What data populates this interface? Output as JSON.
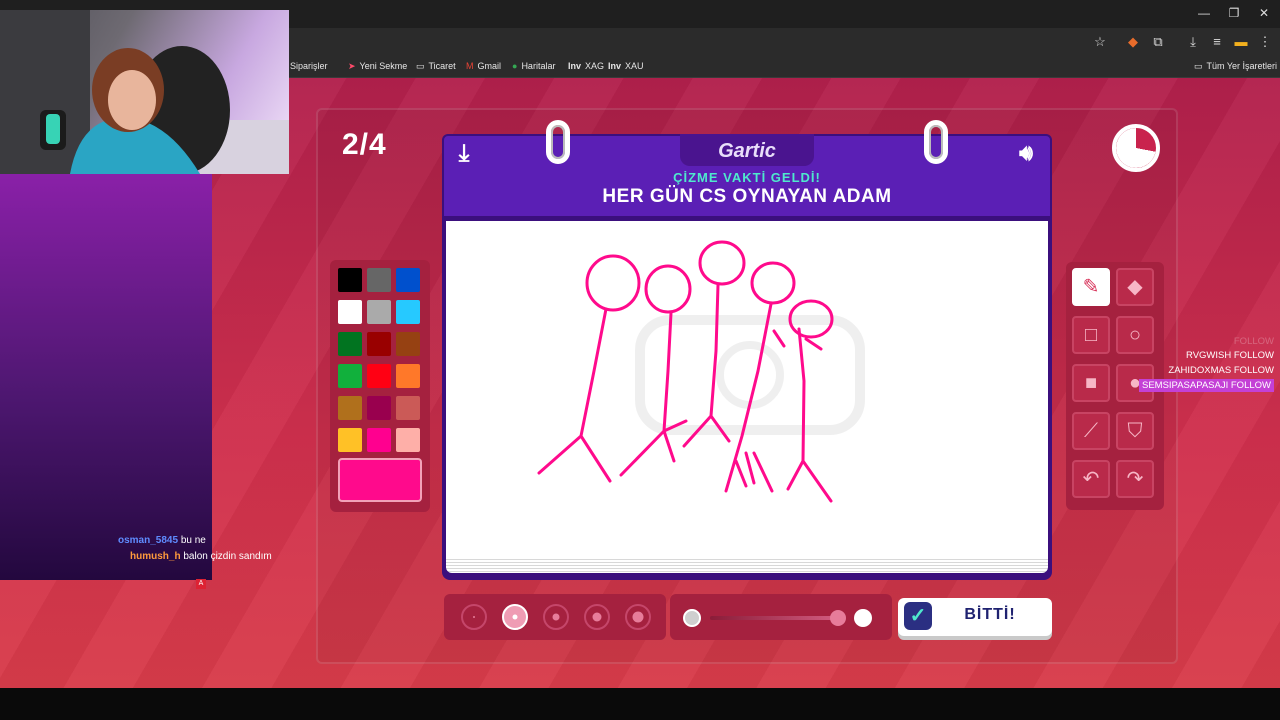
{
  "browser": {
    "window_controls": [
      "—",
      "❐",
      "✕"
    ],
    "bookmarks": [
      {
        "label": "Siparişler",
        "icon": "bookmark-icon"
      },
      {
        "label": "Yeni Sekme",
        "icon": "arrow-icon"
      },
      {
        "label": "Ticaret",
        "icon": "folder-icon"
      },
      {
        "label": "Gmail",
        "icon": "gmail-icon"
      },
      {
        "label": "Haritalar",
        "icon": "maps-icon"
      },
      {
        "label": "XAG",
        "icon": "investing-icon"
      },
      {
        "label": "XAU",
        "icon": "investing-icon"
      }
    ],
    "bookmark_prefix": "Inv",
    "all_bookmarks": "Tüm Yer İşaretleri"
  },
  "game": {
    "round": "2/4",
    "logo": "Gartic",
    "subtitle": "ÇİZME VAKTİ GELDİ!",
    "prompt": "HER GÜN CS OYNAYAN ADAM",
    "done_label": "BİTTİ!",
    "selected_color": "#ff0a8c",
    "timer_remaining_fraction": 0.72,
    "palette": [
      "#000000",
      "#666666",
      "#0050cd",
      "#ffffff",
      "#aaaaaa",
      "#26c9ff",
      "#017420",
      "#990000",
      "#964112",
      "#11b03c",
      "#ff0013",
      "#ff7829",
      "#b0701c",
      "#99004e",
      "#cb5a57",
      "#ffc126",
      "#ff008f",
      "#feafa8"
    ],
    "brush_sizes": 5,
    "active_brush_size": 2,
    "opacity_level": 1.0
  },
  "stream": {
    "chat": [
      {
        "user": "osman_5845",
        "user_color": "#5f8cff",
        "message": "bu ne"
      },
      {
        "user": "humush_h",
        "user_color": "#ff9a3c",
        "message": "balon çizdin sandım"
      }
    ],
    "follows": [
      {
        "name": "",
        "label": "FOLLOW",
        "state": "faded"
      },
      {
        "name": "RVGWISH",
        "label": "FOLLOW",
        "state": "normal"
      },
      {
        "name": "ZAHIDOXMAS",
        "label": "FOLLOW",
        "state": "normal"
      },
      {
        "name": "SEMSIPASAPASAJI",
        "label": "FOLLOW",
        "state": "highlight"
      }
    ]
  }
}
